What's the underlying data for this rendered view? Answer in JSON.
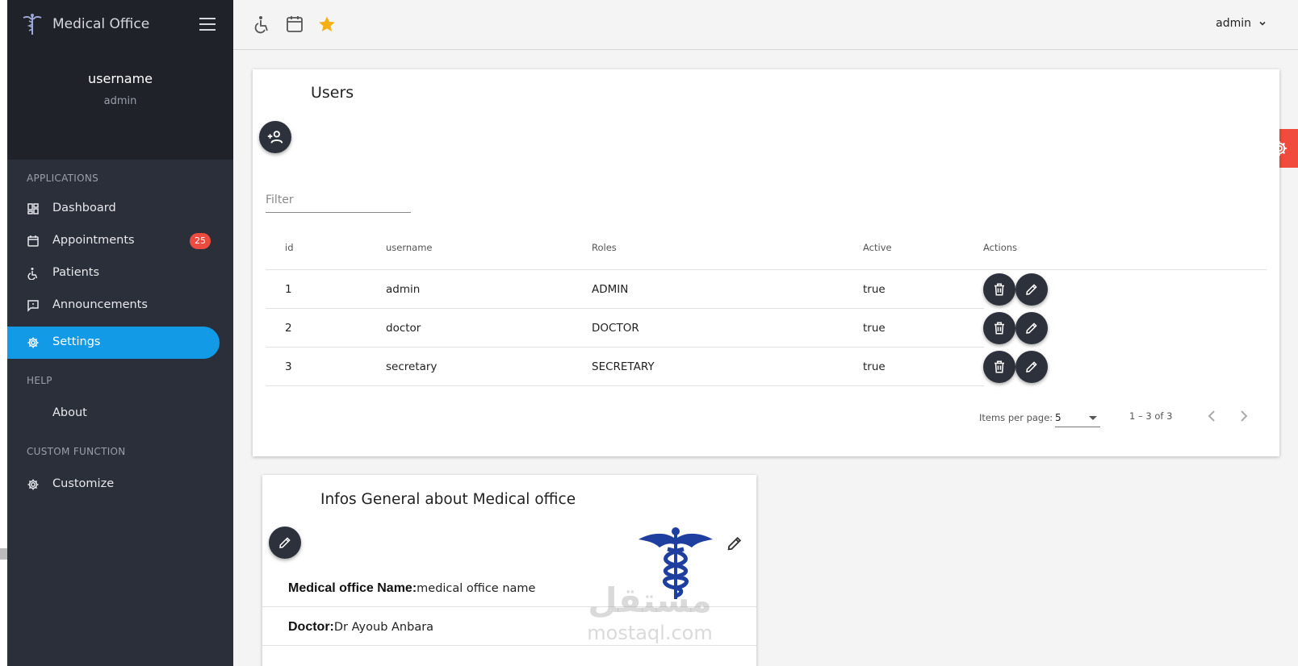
{
  "brand": {
    "title": "Medical Office"
  },
  "user": {
    "name": "username",
    "role": "admin"
  },
  "sidebar": {
    "sections": [
      {
        "title": "APPLICATIONS"
      },
      {
        "title": "HELP"
      },
      {
        "title": "CUSTOM FUNCTION"
      }
    ],
    "items": [
      {
        "label": "Dashboard",
        "icon": "dashboard-icon"
      },
      {
        "label": "Appointments",
        "icon": "calendar-icon",
        "badge": "25"
      },
      {
        "label": "Patients",
        "icon": "wheelchair-icon"
      },
      {
        "label": "Announcements",
        "icon": "announcement-icon"
      },
      {
        "label": "Settings",
        "icon": "gear-icon",
        "active": true
      },
      {
        "label": "About"
      },
      {
        "label": "Customize",
        "icon": "gear-icon"
      }
    ]
  },
  "topbar": {
    "icons": [
      "wheelchair-icon",
      "calendar-icon",
      "star-icon"
    ],
    "user_menu": "admin"
  },
  "users": {
    "title": "Users",
    "filter_placeholder": "Filter",
    "columns": [
      "id",
      "username",
      "Roles",
      "Active",
      "Actions"
    ],
    "rows": [
      {
        "id": "1",
        "username": "admin",
        "roles": "ADMIN",
        "active": "true"
      },
      {
        "id": "2",
        "username": "doctor",
        "roles": "DOCTOR",
        "active": "true"
      },
      {
        "id": "3",
        "username": "secretary",
        "roles": "SECRETARY",
        "active": "true"
      }
    ],
    "paginator": {
      "items_per_page_label": "Items per page:",
      "page_size": "5",
      "range": "1 – 3 of 3"
    }
  },
  "info": {
    "title": "Infos General about Medical office",
    "fields": [
      {
        "label": "Medical office Name:",
        "value": "medical office name"
      },
      {
        "label": "Doctor:",
        "value": "Dr Ayoub Anbara"
      }
    ]
  },
  "watermark": {
    "logo": "مستقل",
    "text": "mostaql.com"
  },
  "colors": {
    "accent": "#129ae6",
    "badge": "#ec4c3f",
    "gear_tab": "#f04b3c",
    "sidebar": "#2b2f3a",
    "fab": "#2d313c"
  }
}
